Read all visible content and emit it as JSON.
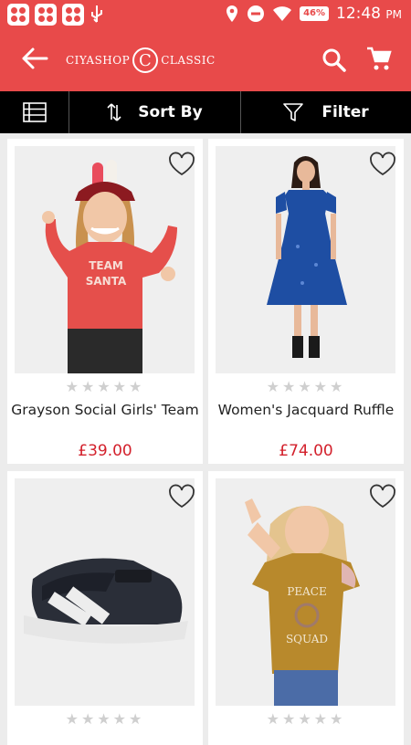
{
  "status_bar": {
    "time": "12:48",
    "ampm": "PM",
    "battery": "46%"
  },
  "header": {
    "logo_left": "CIYASHOP",
    "logo_mark": "C",
    "logo_right": "CLASSIC"
  },
  "toolbar": {
    "sort_label": "Sort By",
    "filter_label": "Filter"
  },
  "products": [
    {
      "name": "Grayson Social Girls' Team",
      "price": "£39.00",
      "rating": "★★★★★"
    },
    {
      "name": "Women's Jacquard Ruffle",
      "price": "£74.00",
      "rating": "★★★★★"
    },
    {
      "name": "",
      "price": "",
      "rating": "★★★★★"
    },
    {
      "name": "",
      "price": "",
      "rating": "★★★★★"
    }
  ],
  "colors": {
    "brand": "#e84a4a",
    "price": "#d3212c",
    "toolbar": "#000000"
  }
}
